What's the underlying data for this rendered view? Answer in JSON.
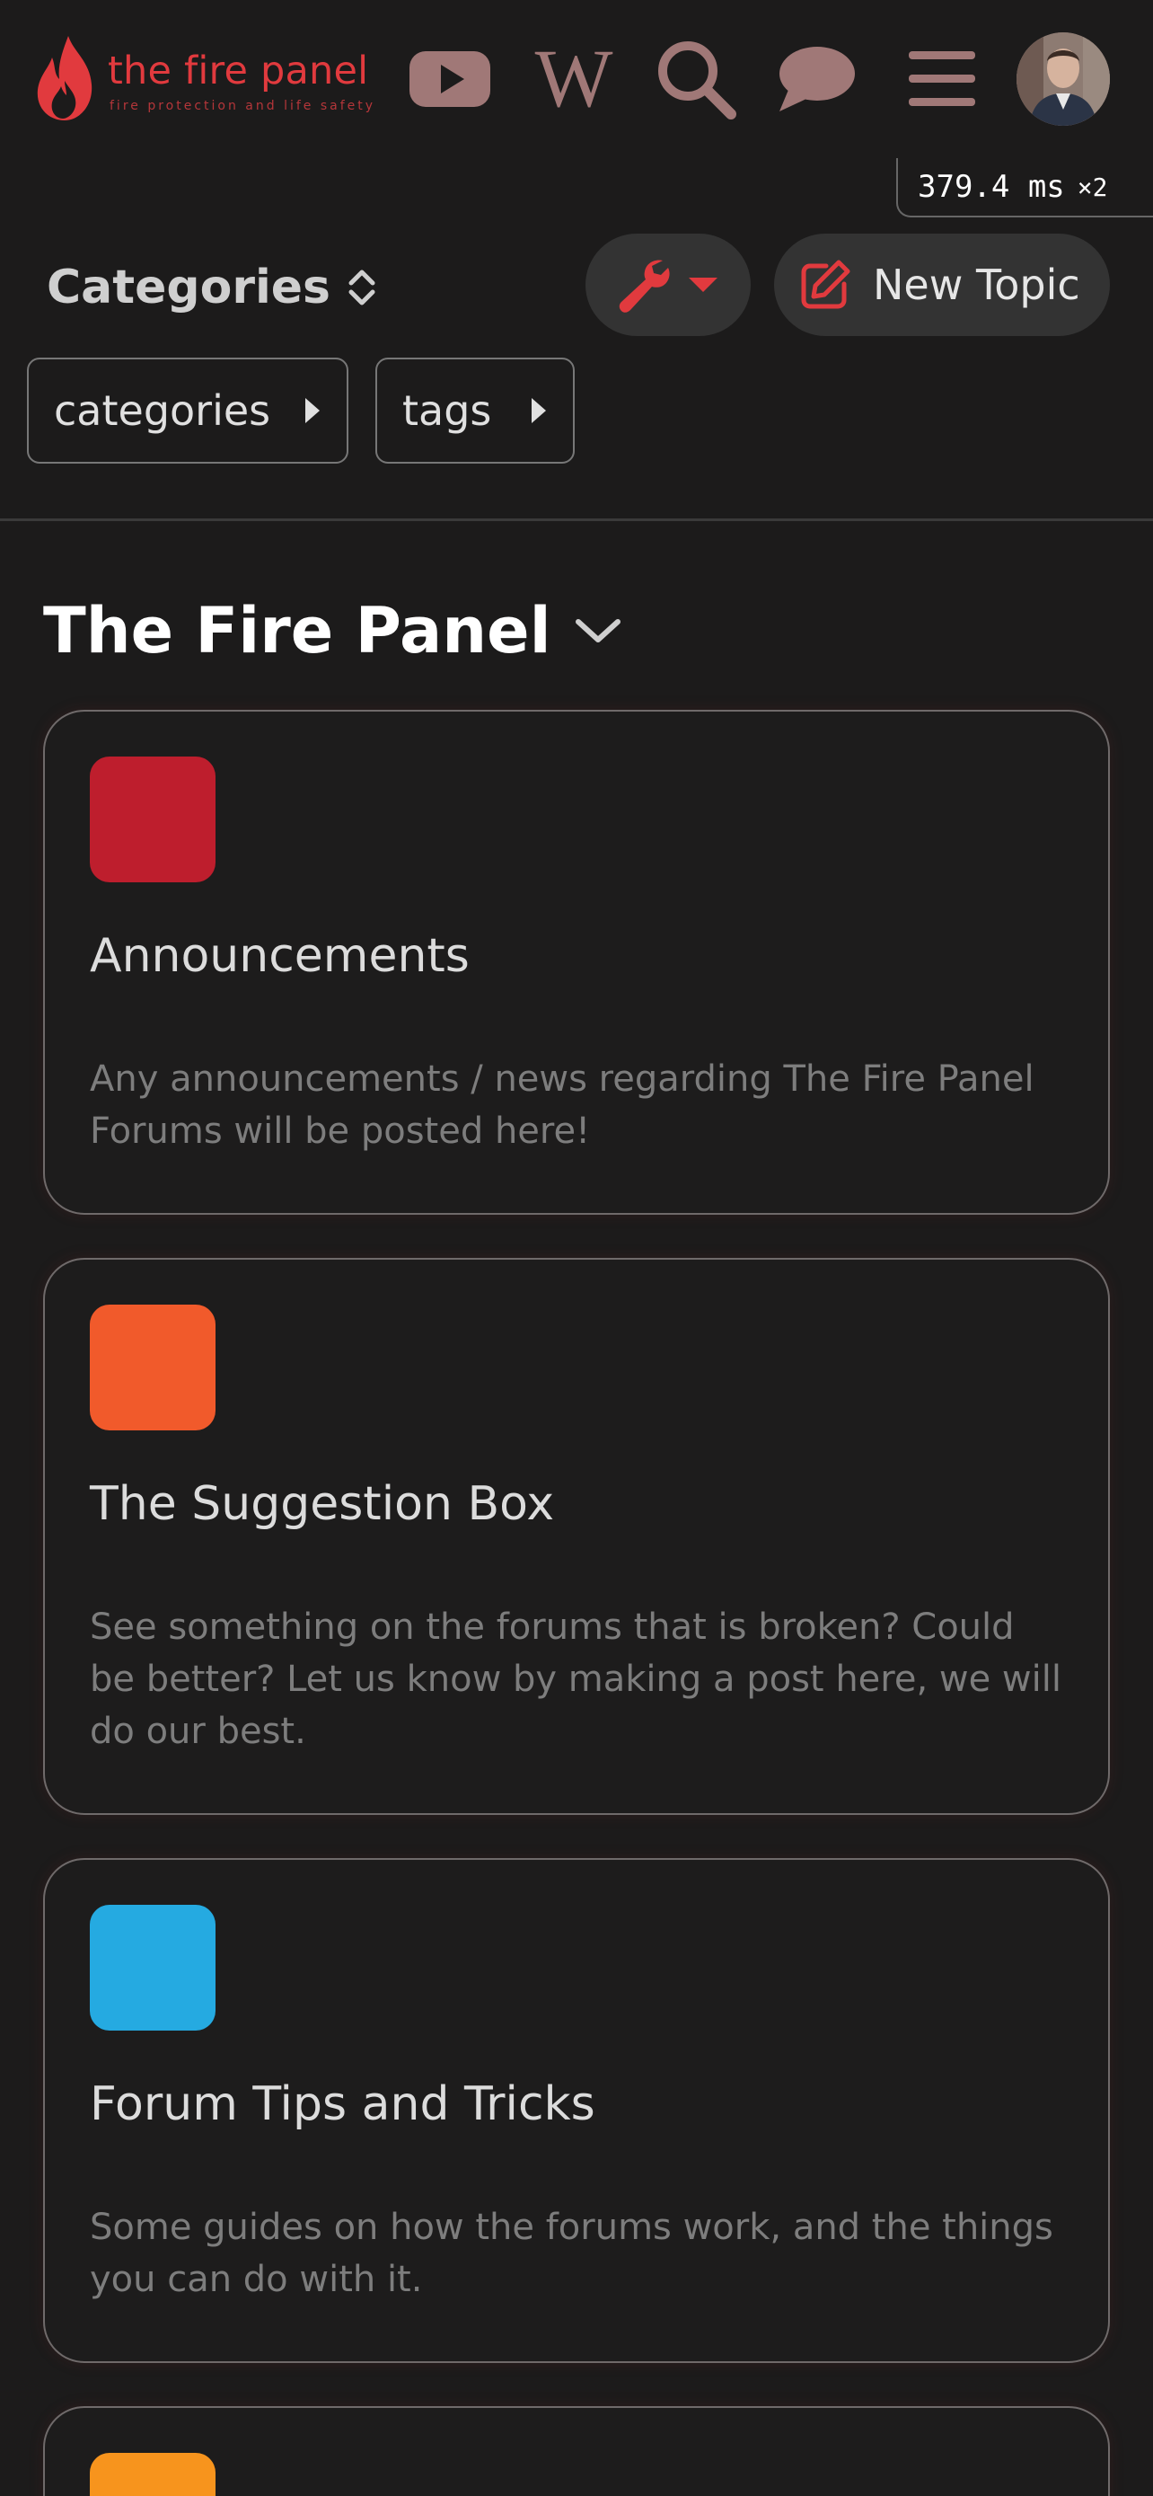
{
  "header": {
    "logo_title": "the fire panel",
    "logo_tagline": "fire protection and life safety",
    "icons": [
      "youtube-icon",
      "wikipedia-icon",
      "search-icon",
      "chat-icon",
      "menu-icon"
    ],
    "wiki_letter": "W",
    "timing_value": "379.4 ms",
    "timing_multiplier": "×2"
  },
  "controls": {
    "categories_label": "Categories",
    "new_topic_label": "New Topic",
    "filters": [
      {
        "label": "categories"
      },
      {
        "label": "tags"
      }
    ]
  },
  "section": {
    "title": "The Fire Panel"
  },
  "categories": [
    {
      "name": "Announcements",
      "description": "Any announcements / news regarding The Fire Panel Forums will be posted here!",
      "color": "#be1e2d"
    },
    {
      "name": "The Suggestion Box",
      "description": "See something on the forums that is broken? Could be better? Let us know by making a post here, we will do our best.",
      "color": "#f15a2b"
    },
    {
      "name": "Forum Tips and Tricks",
      "description": "Some guides on how the forums work, and the things you can do with it.",
      "color": "#25aae1"
    },
    {
      "name": "",
      "description": "",
      "color": "#f7941d"
    }
  ],
  "colors": {
    "accent": "#e13a3e",
    "icon_muted": "#a07877",
    "background": "#1c1b1b"
  }
}
